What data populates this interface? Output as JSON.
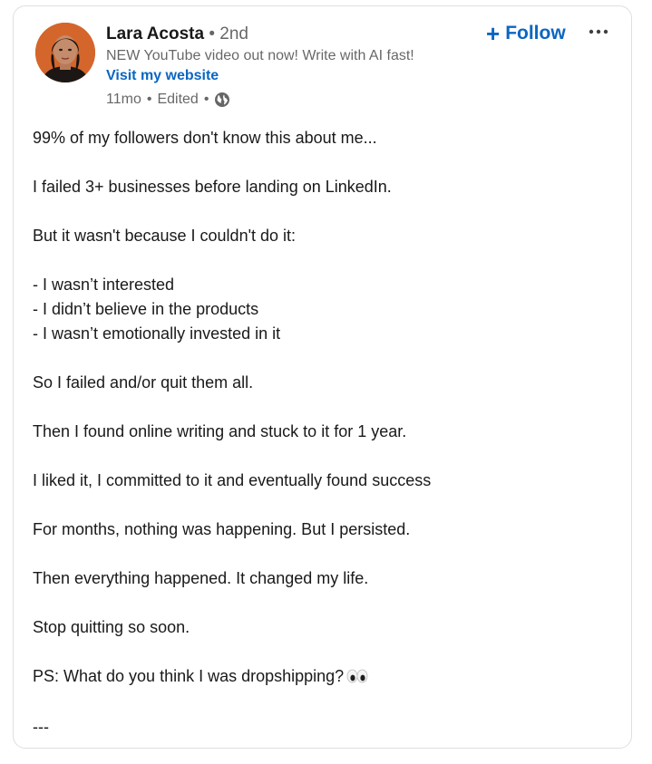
{
  "author": {
    "name": "Lara Acosta",
    "degree_separator": "•",
    "degree": "2nd",
    "tagline": "NEW YouTube video out now! Write with AI fast!",
    "website_link": "Visit my website",
    "avatar_icon": "profile-photo"
  },
  "meta": {
    "time": "11mo",
    "sep1": "•",
    "edited": "Edited",
    "sep2": "•",
    "visibility_icon": "globe-icon"
  },
  "actions": {
    "follow_plus": "+",
    "follow_label": "Follow",
    "more_icon": "ellipsis-icon"
  },
  "post": {
    "line1": "99% of my followers don't know this about me...",
    "line2": "I failed 3+ businesses before landing on LinkedIn.",
    "line3": "But it wasn't because I couldn't do it:",
    "list": [
      "- I wasn’t interested",
      "- I didn’t believe in the products",
      "- I wasn’t emotionally invested in it"
    ],
    "line4": "So I failed and/or quit them all.",
    "line5": "Then I found online writing and stuck to it for 1 year.",
    "line6": "I liked it, I committed to it and eventually found success",
    "line7": "For months, nothing was happening. But I persisted.",
    "line8": "Then everything happened. It changed my life.",
    "line9": "Stop quitting so soon.",
    "line10": "PS: What do you think I was dropshipping?",
    "line10_emoji": "eyes-emoji",
    "divider": "---"
  },
  "colors": {
    "link_blue": "#0a66c2",
    "muted_text": "#666666",
    "card_border": "#e0dfdc"
  }
}
